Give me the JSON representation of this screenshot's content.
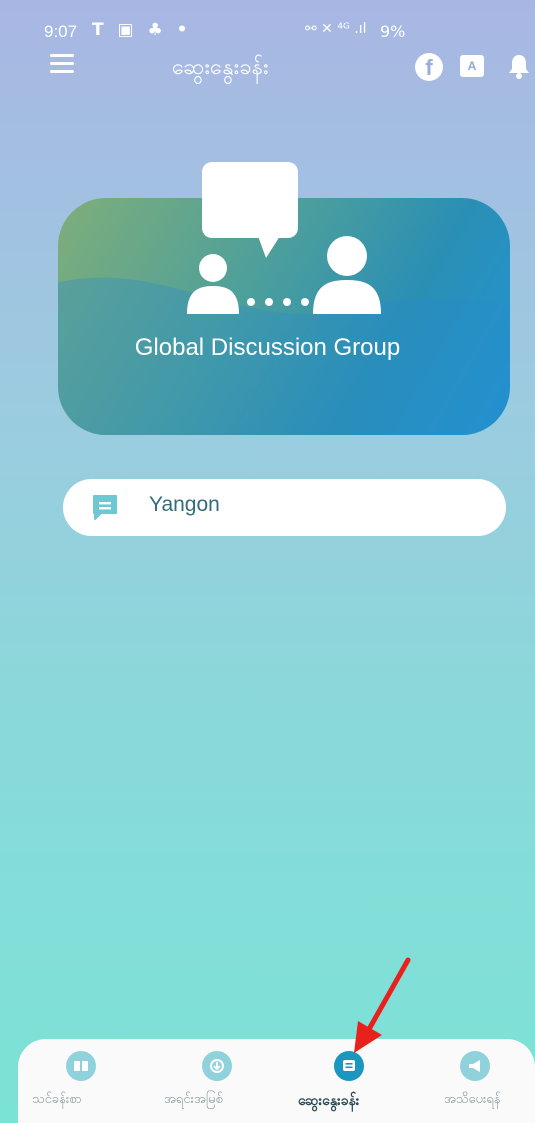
{
  "status_bar": {
    "time": "9:07",
    "left_icons": "T ▣ ♣ •",
    "right_icons": "⚯ ✕ ⁴ᴳ .ıl",
    "battery": "9%"
  },
  "header": {
    "title": "ဆွေးနွေးခန်း",
    "icons": [
      "menu-icon",
      "facebook-icon",
      "translate-icon",
      "bell-icon"
    ],
    "translate_label": "A"
  },
  "banner": {
    "title": "Global Discussion Group"
  },
  "channels": [
    {
      "label": "Yangon"
    }
  ],
  "bottom_nav": {
    "items": [
      {
        "label": "သင်ခန်းစာ",
        "icon": "book-icon",
        "active": false
      },
      {
        "label": "အရင်းအမြစ်",
        "icon": "download-icon",
        "active": false
      },
      {
        "label": "ဆွေးနွေးခန်း",
        "icon": "chat-icon",
        "active": true
      },
      {
        "label": "အသိပေးရန်",
        "icon": "megaphone-icon",
        "active": false
      }
    ]
  },
  "colors": {
    "accent": "#1b96bf",
    "annotation": "#e8211c"
  }
}
